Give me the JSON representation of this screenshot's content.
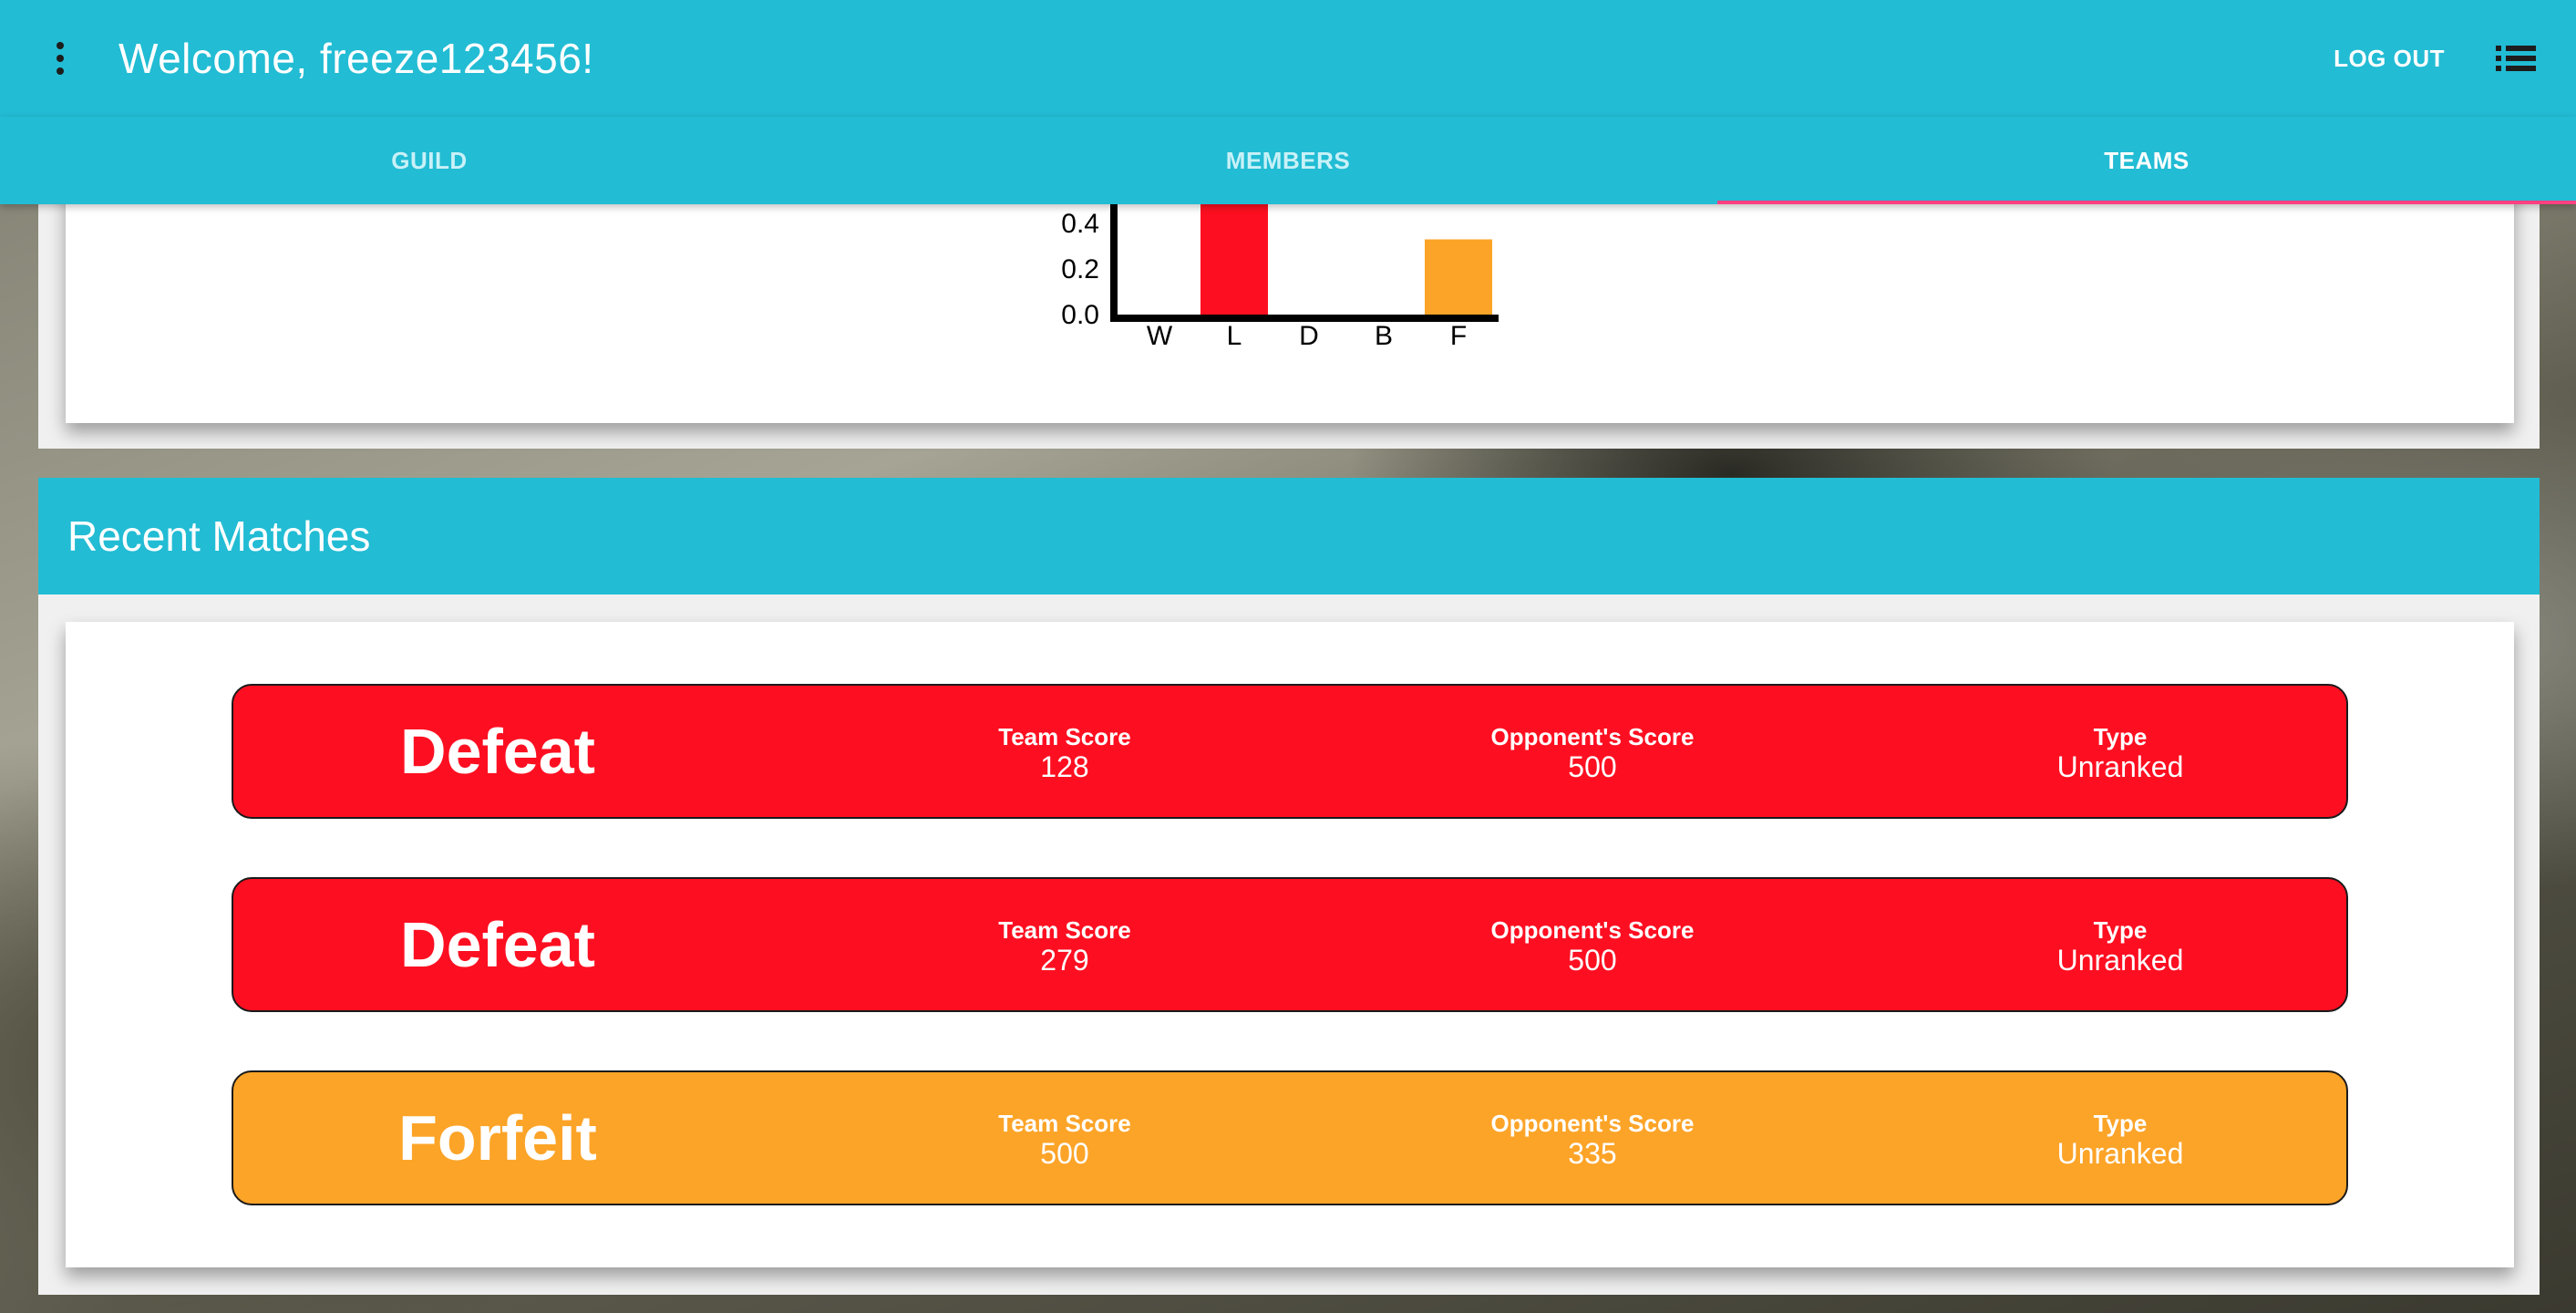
{
  "header": {
    "title": "Welcome, freeze123456!",
    "logout_label": "LOG OUT"
  },
  "tabs": [
    {
      "label": "GUILD",
      "active": false
    },
    {
      "label": "MEMBERS",
      "active": false
    },
    {
      "label": "TEAMS",
      "active": true
    }
  ],
  "chart_data": {
    "type": "bar",
    "categories": [
      "W",
      "L",
      "D",
      "B",
      "F"
    ],
    "values": [
      0,
      0.67,
      0,
      0,
      0.33
    ],
    "colors": [
      "#fd0f21",
      "#fd0f21",
      "#fd0f21",
      "#fd0f21",
      "#fca428"
    ],
    "ytick_labels": [
      "0.0",
      "0.2",
      "0.4"
    ],
    "yticks": [
      0,
      0.2,
      0.4
    ],
    "title": "",
    "xlabel": "",
    "ylabel": "",
    "note": "chart is partially scrolled out of view above 0.4"
  },
  "recent_matches": {
    "title": "Recent Matches",
    "labels": {
      "team_score": "Team Score",
      "opponent_score": "Opponent's Score",
      "type": "Type"
    },
    "items": [
      {
        "result": "Defeat",
        "team_score": "128",
        "opponent_score": "500",
        "type": "Unranked",
        "color": "#fd0f21"
      },
      {
        "result": "Defeat",
        "team_score": "279",
        "opponent_score": "500",
        "type": "Unranked",
        "color": "#fd0f21"
      },
      {
        "result": "Forfeit",
        "team_score": "500",
        "opponent_score": "335",
        "type": "Unranked",
        "color": "#fca428"
      }
    ]
  },
  "colors": {
    "primary": "#22bcd4",
    "accent": "#ff4081",
    "defeat": "#fd0f21",
    "forfeit": "#fca428"
  },
  "icons": {
    "menu": "more-vert-icon",
    "list": "list-icon"
  }
}
